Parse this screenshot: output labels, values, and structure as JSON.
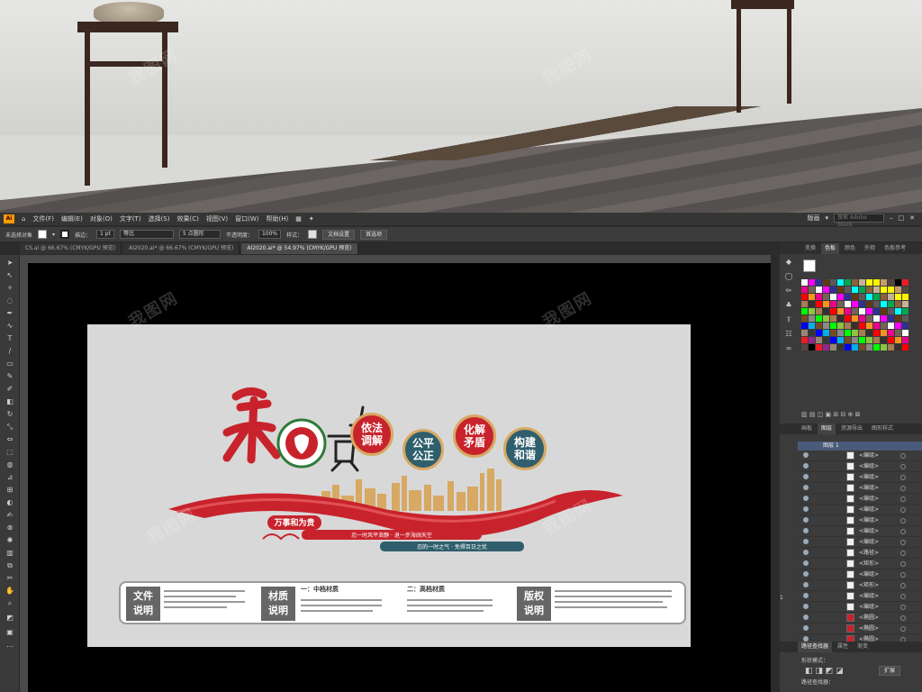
{
  "menubar": {
    "app_label": "Ai",
    "items": [
      "文件(F)",
      "编辑(E)",
      "对象(O)",
      "文字(T)",
      "选择(S)",
      "效果(C)",
      "视图(V)",
      "窗口(W)",
      "帮助(H)"
    ],
    "workspace": "版画",
    "search_placeholder": "搜索 Adobe Stock"
  },
  "control_bar": {
    "selection_label": "未选择对象",
    "stroke_label": "描边：",
    "stroke_value": "1 pt",
    "profile_label": "等比",
    "brush_label": "5 点圆形",
    "opacity_label": "不透明度：",
    "opacity_value": "100%",
    "style_label": "样式：",
    "doc_setup_btn": "文档设置",
    "prefs_btn": "首选项"
  },
  "doc_tabs": [
    "CS.ai @ 66.67% (CMYK/GPU 预览)",
    "AI2020.ai* @ 66.67% (CMYK/GPU 预览)",
    "AI2020.ai* @ 54.97% (CMYK/GPU 预览)"
  ],
  "right_panel": {
    "top_tabs": [
      "变换",
      "色板",
      "颜色",
      "外观",
      "色板参考"
    ],
    "layer_tabs": [
      "画板",
      "图层",
      "资源导出",
      "图形样式"
    ],
    "layer_name": "图层 1",
    "layer_rows": [
      "<编组>",
      "<编组>",
      "<编组>",
      "<编组>",
      "<编组>",
      "<编组>",
      "<编组>",
      "<编组>",
      "<编组>",
      "<路径>",
      "<矩形>",
      "<编组>",
      "<矩形>",
      "<编组>",
      "<编组>",
      "<椭圆>",
      "<椭圆>",
      "<椭圆>",
      "<椭圆>",
      "<椭圆>"
    ],
    "pathfinder_tabs": [
      "路径查找器",
      "属性",
      "渐变"
    ],
    "shape_mode_label": "形状模式：",
    "pathfinder_label": "路径查找器：",
    "expand_btn": "扩展",
    "footer_count": "1"
  },
  "artwork": {
    "headline": "和为贵",
    "round_labels": [
      "依法\n调解",
      "公平\n公正",
      "化解\n矛盾",
      "构建\n和谐"
    ],
    "slogan_main": "万事和为贵",
    "slogan_line1": "忍一时风平浪静 · 退一步海阔天空",
    "slogan_line2": "忍的一时之气 · 免得百日之忧",
    "info_blocks": [
      {
        "title": "文件\n说明"
      },
      {
        "title": "材质\n说明",
        "heading": "一：中档材质"
      },
      {
        "heading": "二：高档材质"
      },
      {
        "title": "版权\n说明"
      }
    ]
  },
  "watermark": "我图网",
  "colors": {
    "brand_red": "#c8232c",
    "teal": "#2f5f6d",
    "gold": "#d7a964",
    "ui_dark": "#3b3b3b"
  }
}
